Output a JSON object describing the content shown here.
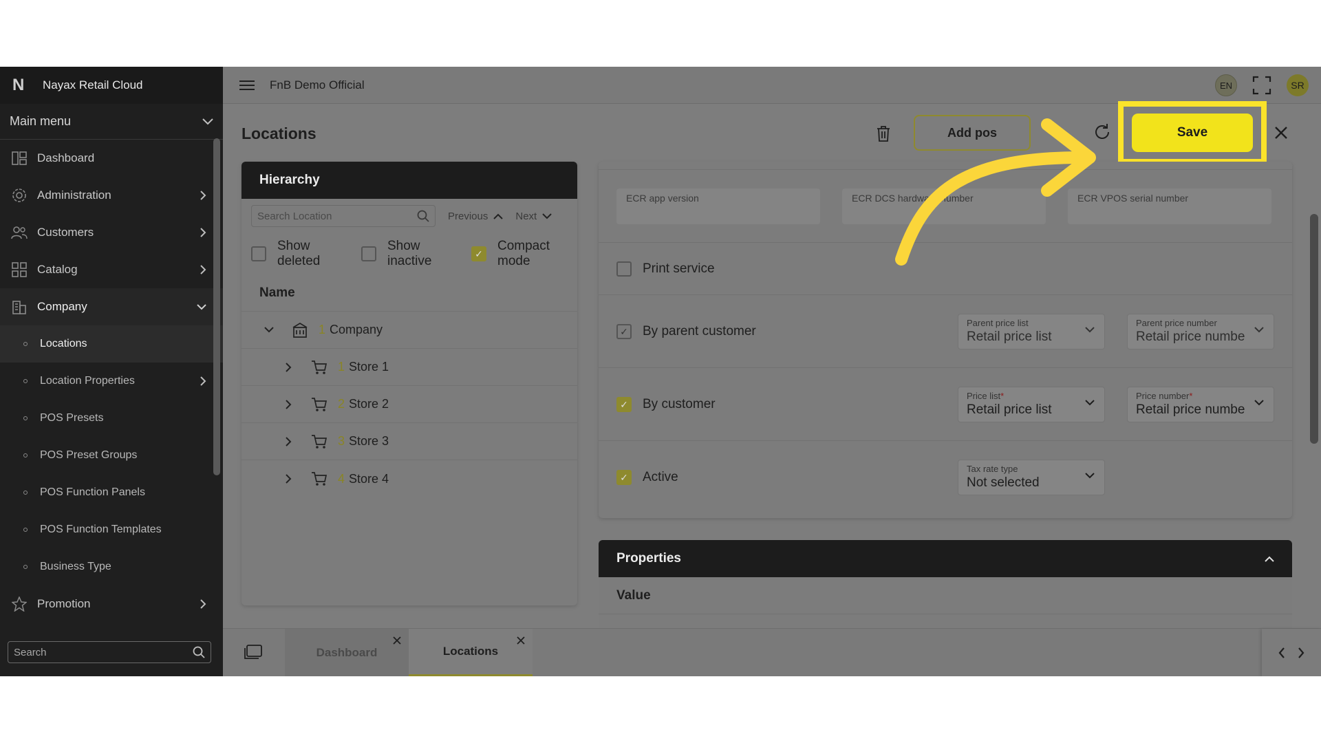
{
  "app": {
    "brand_logo": "N",
    "brand_name": "Nayax Retail Cloud",
    "org_name": "FnB Demo Official"
  },
  "sidebar": {
    "main_menu_label": "Main menu",
    "items": [
      {
        "label": "Dashboard",
        "icon": "dashboard-icon"
      },
      {
        "label": "Administration",
        "icon": "gear-icon"
      },
      {
        "label": "Customers",
        "icon": "users-icon"
      },
      {
        "label": "Catalog",
        "icon": "grid-icon"
      },
      {
        "label": "Company",
        "icon": "building-icon"
      }
    ],
    "company_sub": [
      "Locations",
      "Location Properties",
      "POS Presets",
      "POS Preset Groups",
      "POS Function Panels",
      "POS Function Templates",
      "Business Type"
    ],
    "promotion_label": "Promotion",
    "search_placeholder": "Search"
  },
  "topbar": {
    "lang": "EN",
    "avatar_initials": "SR"
  },
  "page": {
    "title": "Locations",
    "add_pos_label": "Add pos",
    "save_label": "Save"
  },
  "hierarchy": {
    "title": "Hierarchy",
    "search_placeholder": "Search Location",
    "previous_label": "Previous",
    "next_label": "Next",
    "show_deleted": "Show deleted",
    "show_inactive": "Show inactive",
    "compact_mode": "Compact mode",
    "name_header": "Name",
    "root": {
      "num": "1",
      "name": "Company"
    },
    "stores": [
      {
        "num": "1",
        "name": "Store 1"
      },
      {
        "num": "2",
        "name": "Store 2"
      },
      {
        "num": "3",
        "name": "Store 3"
      },
      {
        "num": "4",
        "name": "Store 4"
      }
    ]
  },
  "details": {
    "ecr_app_version": "ECR app version",
    "ecr_dcs_hardware": "ECR DCS hardware number",
    "ecr_vpos_serial": "ECR VPOS serial number",
    "print_service": "Print service",
    "by_parent_customer": "By parent customer",
    "parent_price_list_label": "Parent price list",
    "parent_price_list_value": "Retail price list",
    "parent_price_number_label": "Parent price number",
    "parent_price_number_value": "Retail price numbe",
    "by_customer": "By customer",
    "price_list_label": "Price list",
    "price_list_value": "Retail price list",
    "price_number_label": "Price number",
    "price_number_value": "Retail price numbe",
    "required_mark": "*",
    "active": "Active",
    "tax_rate_label": "Tax rate type",
    "tax_rate_value": "Not selected"
  },
  "properties": {
    "title": "Properties",
    "value_header": "Value"
  },
  "tabs": [
    {
      "label": "Dashboard"
    },
    {
      "label": "Locations"
    }
  ],
  "colors": {
    "accent": "#f2e31b",
    "highlight_border": "#fbe32b",
    "sidebar_bg": "#1f1f1f",
    "arrow": "#fbd63a"
  }
}
